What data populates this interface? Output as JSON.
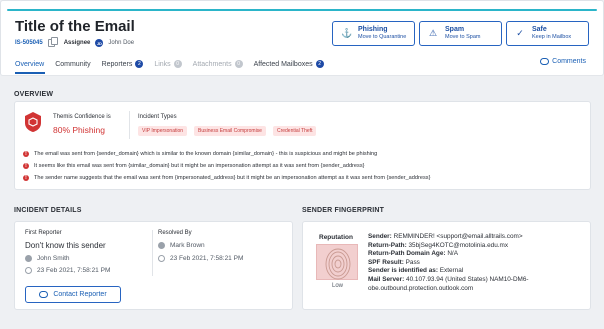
{
  "header": {
    "title": "Title of the Email",
    "id": "IS-505045",
    "assignee_label": "Assignee",
    "assignee_initials": "JD",
    "assignee_name": "John Doe"
  },
  "actions": [
    {
      "label": "Phishing",
      "sub": "Move to Quarantine",
      "icon": "phishing-hook-icon"
    },
    {
      "label": "Spam",
      "sub": "Move to Spam",
      "icon": "warning-triangle-icon"
    },
    {
      "label": "Safe",
      "sub": "Keep in Mailbox",
      "icon": "shield-check-icon"
    }
  ],
  "tabs": [
    {
      "label": "Overview",
      "badge": null
    },
    {
      "label": "Community",
      "badge": null
    },
    {
      "label": "Reporters",
      "badge": "2"
    },
    {
      "label": "Links",
      "badge": "0"
    },
    {
      "label": "Attachments",
      "badge": "0"
    },
    {
      "label": "Affected Mailboxes",
      "badge": "2"
    }
  ],
  "comments_label": "Comments",
  "overview": {
    "section_title": "OVERVIEW",
    "confidence_label": "Themis Confidence is",
    "confidence_value": "80% Phishing",
    "types_label": "Incident Types",
    "tags": [
      "VIP Impersonation",
      "Business Email Compromise",
      "Credential Theft"
    ],
    "warnings": [
      "The email was sent from {sender_domain} which is similar to the known domain {similar_domain} - this is suspicious and might be phishing",
      "It seems like this email was sent from {similar_domain} but it might be an impersonation attempt as it was sent from {sender_address}",
      "The sender name suggests that the email was sent from {impersonated_address} but it might be an impersonation attempt as it was sent from {sender_address}"
    ]
  },
  "incident": {
    "section_title": "INCIDENT DETAILS",
    "first_reporter_label": "First Reporter",
    "sender_status": "Don't know this sender",
    "first_reporter_name": "John Smith",
    "first_reporter_time": "23 Feb 2021, 7:58:21 PM",
    "resolved_label": "Resolved By",
    "resolved_name": "Mark Brown",
    "resolved_time": "23 Feb 2021, 7:58:21 PM",
    "contact_button": "Contact Reporter"
  },
  "fingerprint": {
    "section_title": "SENDER FINGERPRINT",
    "reputation_label": "Reputation",
    "reputation_value": "Low",
    "fields": [
      {
        "label": "Sender:",
        "value": "REMMINDER! <support@email.alltrails.com>"
      },
      {
        "label": "Return-Path:",
        "value": "35bjSeg4KOTC@motolinia.edu.mx"
      },
      {
        "label": "Return-Path Domain Age:",
        "value": "N/A"
      },
      {
        "label": "SPF Result:",
        "value": "Pass"
      },
      {
        "label": "Sender is identified as:",
        "value": "External"
      },
      {
        "label": "Mail Server:",
        "value": "40.107.93.94 (United States) NAM10-DM6-obe.outbound.protection.outlook.com"
      }
    ]
  }
}
